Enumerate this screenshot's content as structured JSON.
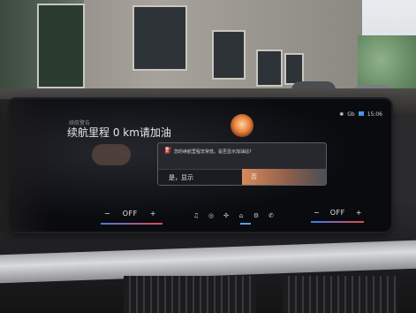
{
  "screen": {
    "status": {
      "bluetooth": "✱",
      "wifi": "Gb",
      "signal": "▮",
      "time": "15:06"
    },
    "warning_label": "续航警告",
    "range_message": "续航里程 0 km请加油",
    "dialog": {
      "message": "您的续航里程非常低。是否显示加油站?",
      "yes_label": "是，显示",
      "no_label": "否"
    },
    "climate": {
      "left": {
        "minus": "−",
        "value": "OFF",
        "plus": "+"
      },
      "right": {
        "minus": "−",
        "value": "OFF",
        "plus": "+"
      }
    },
    "nav_icons": [
      "music-icon",
      "media-icon",
      "fan-icon",
      "home-icon",
      "seat-icon",
      "phone-icon"
    ],
    "nav_glyphs": [
      "♫",
      "◎",
      "✣",
      "⌂",
      "⚙",
      "✆"
    ]
  },
  "colors": {
    "accent_blue": "#3c7ee6",
    "accent_red": "#e04a4a",
    "dialog_highlight": "#d98a5a"
  }
}
